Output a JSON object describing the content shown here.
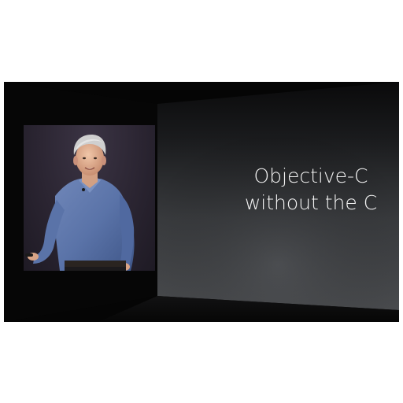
{
  "slide": {
    "line1": "Objective-C",
    "line2": "without the C"
  },
  "colors": {
    "page_background": "#ffffff",
    "stage_background": "#050505",
    "slide_text": "#f4f4f4",
    "presenter_backdrop": "#2b2532",
    "shirt": "#5a73a8"
  },
  "image": {
    "subject": "presenter on stage in blue shirt",
    "slide_icons": []
  }
}
